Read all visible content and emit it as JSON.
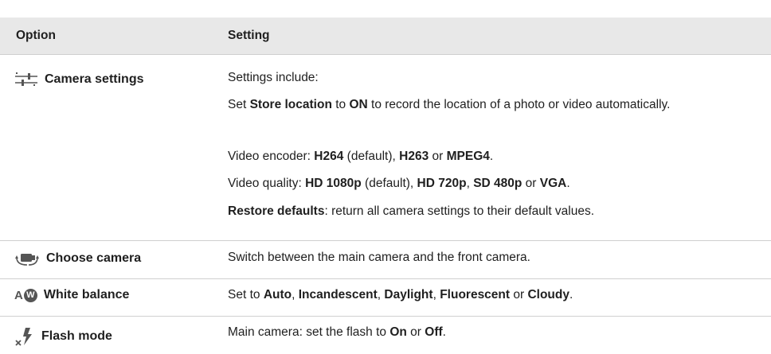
{
  "header": {
    "option": "Option",
    "setting": "Setting"
  },
  "rows": [
    {
      "option": "Camera settings",
      "icon": "sliders-icon",
      "paragraphs": [
        [
          {
            "t": "Settings include:",
            "b": false
          }
        ],
        [
          {
            "t": "Set ",
            "b": false
          },
          {
            "t": "Store location",
            "b": true
          },
          {
            "t": " to ",
            "b": false
          },
          {
            "t": "ON",
            "b": true
          },
          {
            "t": " to record the location of a photo or video automatically.",
            "b": false
          }
        ],
        [
          {
            "t": "Video encoder: ",
            "b": false
          },
          {
            "t": "H264",
            "b": true
          },
          {
            "t": " (default), ",
            "b": false
          },
          {
            "t": "H263",
            "b": true
          },
          {
            "t": " or ",
            "b": false
          },
          {
            "t": "MPEG4",
            "b": true
          },
          {
            "t": ".",
            "b": false
          }
        ],
        [
          {
            "t": "Video quality: ",
            "b": false
          },
          {
            "t": "HD 1080p",
            "b": true
          },
          {
            "t": " (default), ",
            "b": false
          },
          {
            "t": "HD 720p",
            "b": true
          },
          {
            "t": ", ",
            "b": false
          },
          {
            "t": "SD 480p",
            "b": true
          },
          {
            "t": " or ",
            "b": false
          },
          {
            "t": "VGA",
            "b": true
          },
          {
            "t": ".",
            "b": false
          }
        ],
        [
          {
            "t": "Restore defaults",
            "b": true
          },
          {
            "t": ": return all camera settings to their default values.",
            "b": false
          }
        ]
      ]
    },
    {
      "option": "Choose camera",
      "icon": "switch-camera-icon",
      "paragraphs": [
        [
          {
            "t": "Switch between the main camera and the front camera.",
            "b": false
          }
        ]
      ]
    },
    {
      "option": "White balance",
      "icon": "auto-white-balance-icon",
      "icon_text": "A",
      "icon_badge": "W",
      "paragraphs": [
        [
          {
            "t": "Set to ",
            "b": false
          },
          {
            "t": "Auto",
            "b": true
          },
          {
            "t": ", ",
            "b": false
          },
          {
            "t": "Incandescent",
            "b": true
          },
          {
            "t": ", ",
            "b": false
          },
          {
            "t": "Daylight",
            "b": true
          },
          {
            "t": ", ",
            "b": false
          },
          {
            "t": "Fluorescent",
            "b": true
          },
          {
            "t": " or ",
            "b": false
          },
          {
            "t": "Cloudy",
            "b": true
          },
          {
            "t": ".",
            "b": false
          }
        ]
      ]
    },
    {
      "option": "Flash mode",
      "icon": "flash-off-icon",
      "paragraphs": [
        [
          {
            "t": "Main camera: set the flash to ",
            "b": false
          },
          {
            "t": "On",
            "b": true
          },
          {
            "t": " or ",
            "b": false
          },
          {
            "t": "Off",
            "b": true
          },
          {
            "t": ".",
            "b": false
          }
        ]
      ]
    }
  ]
}
